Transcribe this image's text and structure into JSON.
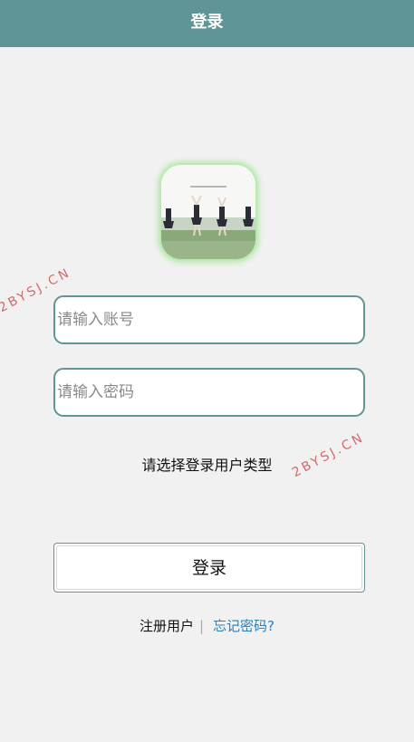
{
  "header": {
    "title": "登录"
  },
  "avatar": {
    "icon": "avatar-photo",
    "glow_color": "#a8e59a"
  },
  "form": {
    "account_placeholder": "请输入账号",
    "password_placeholder": "请输入密码",
    "user_type_label": "请选择登录用户类型",
    "login_label": "登录"
  },
  "links": {
    "register": "注册用户",
    "separator": "|",
    "forgot": "忘记密码?"
  },
  "watermark": {
    "text": "2BYSJ.CN"
  },
  "colors": {
    "header_bg": "#5f9596",
    "page_bg": "#f1f1f1",
    "input_border": "#5f9596",
    "link": "#2b7fb8"
  }
}
